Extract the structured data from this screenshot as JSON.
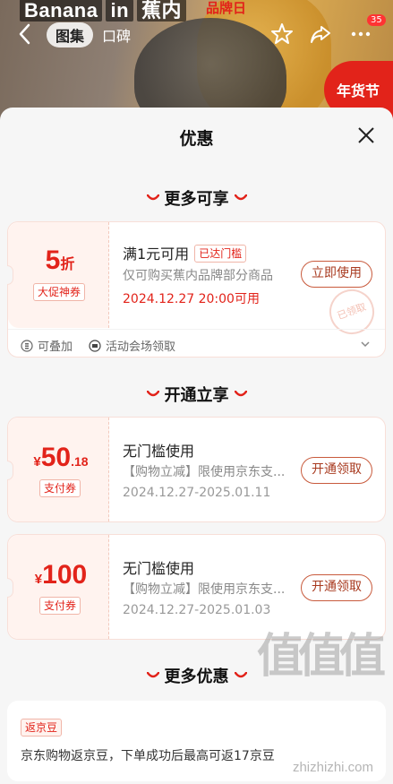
{
  "background": {
    "brand_words": [
      "Banana",
      "in",
      "蕉内"
    ],
    "promo_text": "品牌日",
    "tabs": [
      {
        "label": "图集",
        "active": true
      },
      {
        "label": "口碑",
        "active": false
      }
    ],
    "more_badge": "35",
    "nianhuo_label": "年货节"
  },
  "sheet": {
    "title": "优惠",
    "sections": {
      "more_available": "更多可享",
      "open_enjoy": "开通立享",
      "more_offers": "更多优惠"
    }
  },
  "coupon_main": {
    "value": "5",
    "unit": "折",
    "tag": "大促神券",
    "title": "满1元可用",
    "badge": "已达门槛",
    "desc": "仅可购买蕉内品牌部分商品",
    "date": "2024.12.27 20:00可用",
    "button": "立即使用",
    "stamp": "已领取",
    "footer_stack": "可叠加",
    "footer_source": "活动会场领取"
  },
  "coupon_pay1": {
    "currency": "¥",
    "value_int": "50",
    "value_dec": ".18",
    "tag": "支付券",
    "title": "无门槛使用",
    "desc": "【购物立减】限使用京东支...",
    "date": "2024.12.27-2025.01.11",
    "button": "开通领取"
  },
  "coupon_pay2": {
    "currency": "¥",
    "value_int": "100",
    "tag": "支付券",
    "title": "无门槛使用",
    "desc": "【购物立减】限使用京东支...",
    "date": "2024.12.27-2025.01.03",
    "button": "开通领取"
  },
  "bean": {
    "tag": "返京豆",
    "text": "京东购物返京豆，下单成功后最高可返17京豆"
  },
  "watermark": {
    "text": "值值值",
    "site": "zhizhizhi.com"
  },
  "colors": {
    "accent": "#e2231a",
    "button_border": "#c85a3c",
    "sheet_bg": "#f6f6f6"
  }
}
